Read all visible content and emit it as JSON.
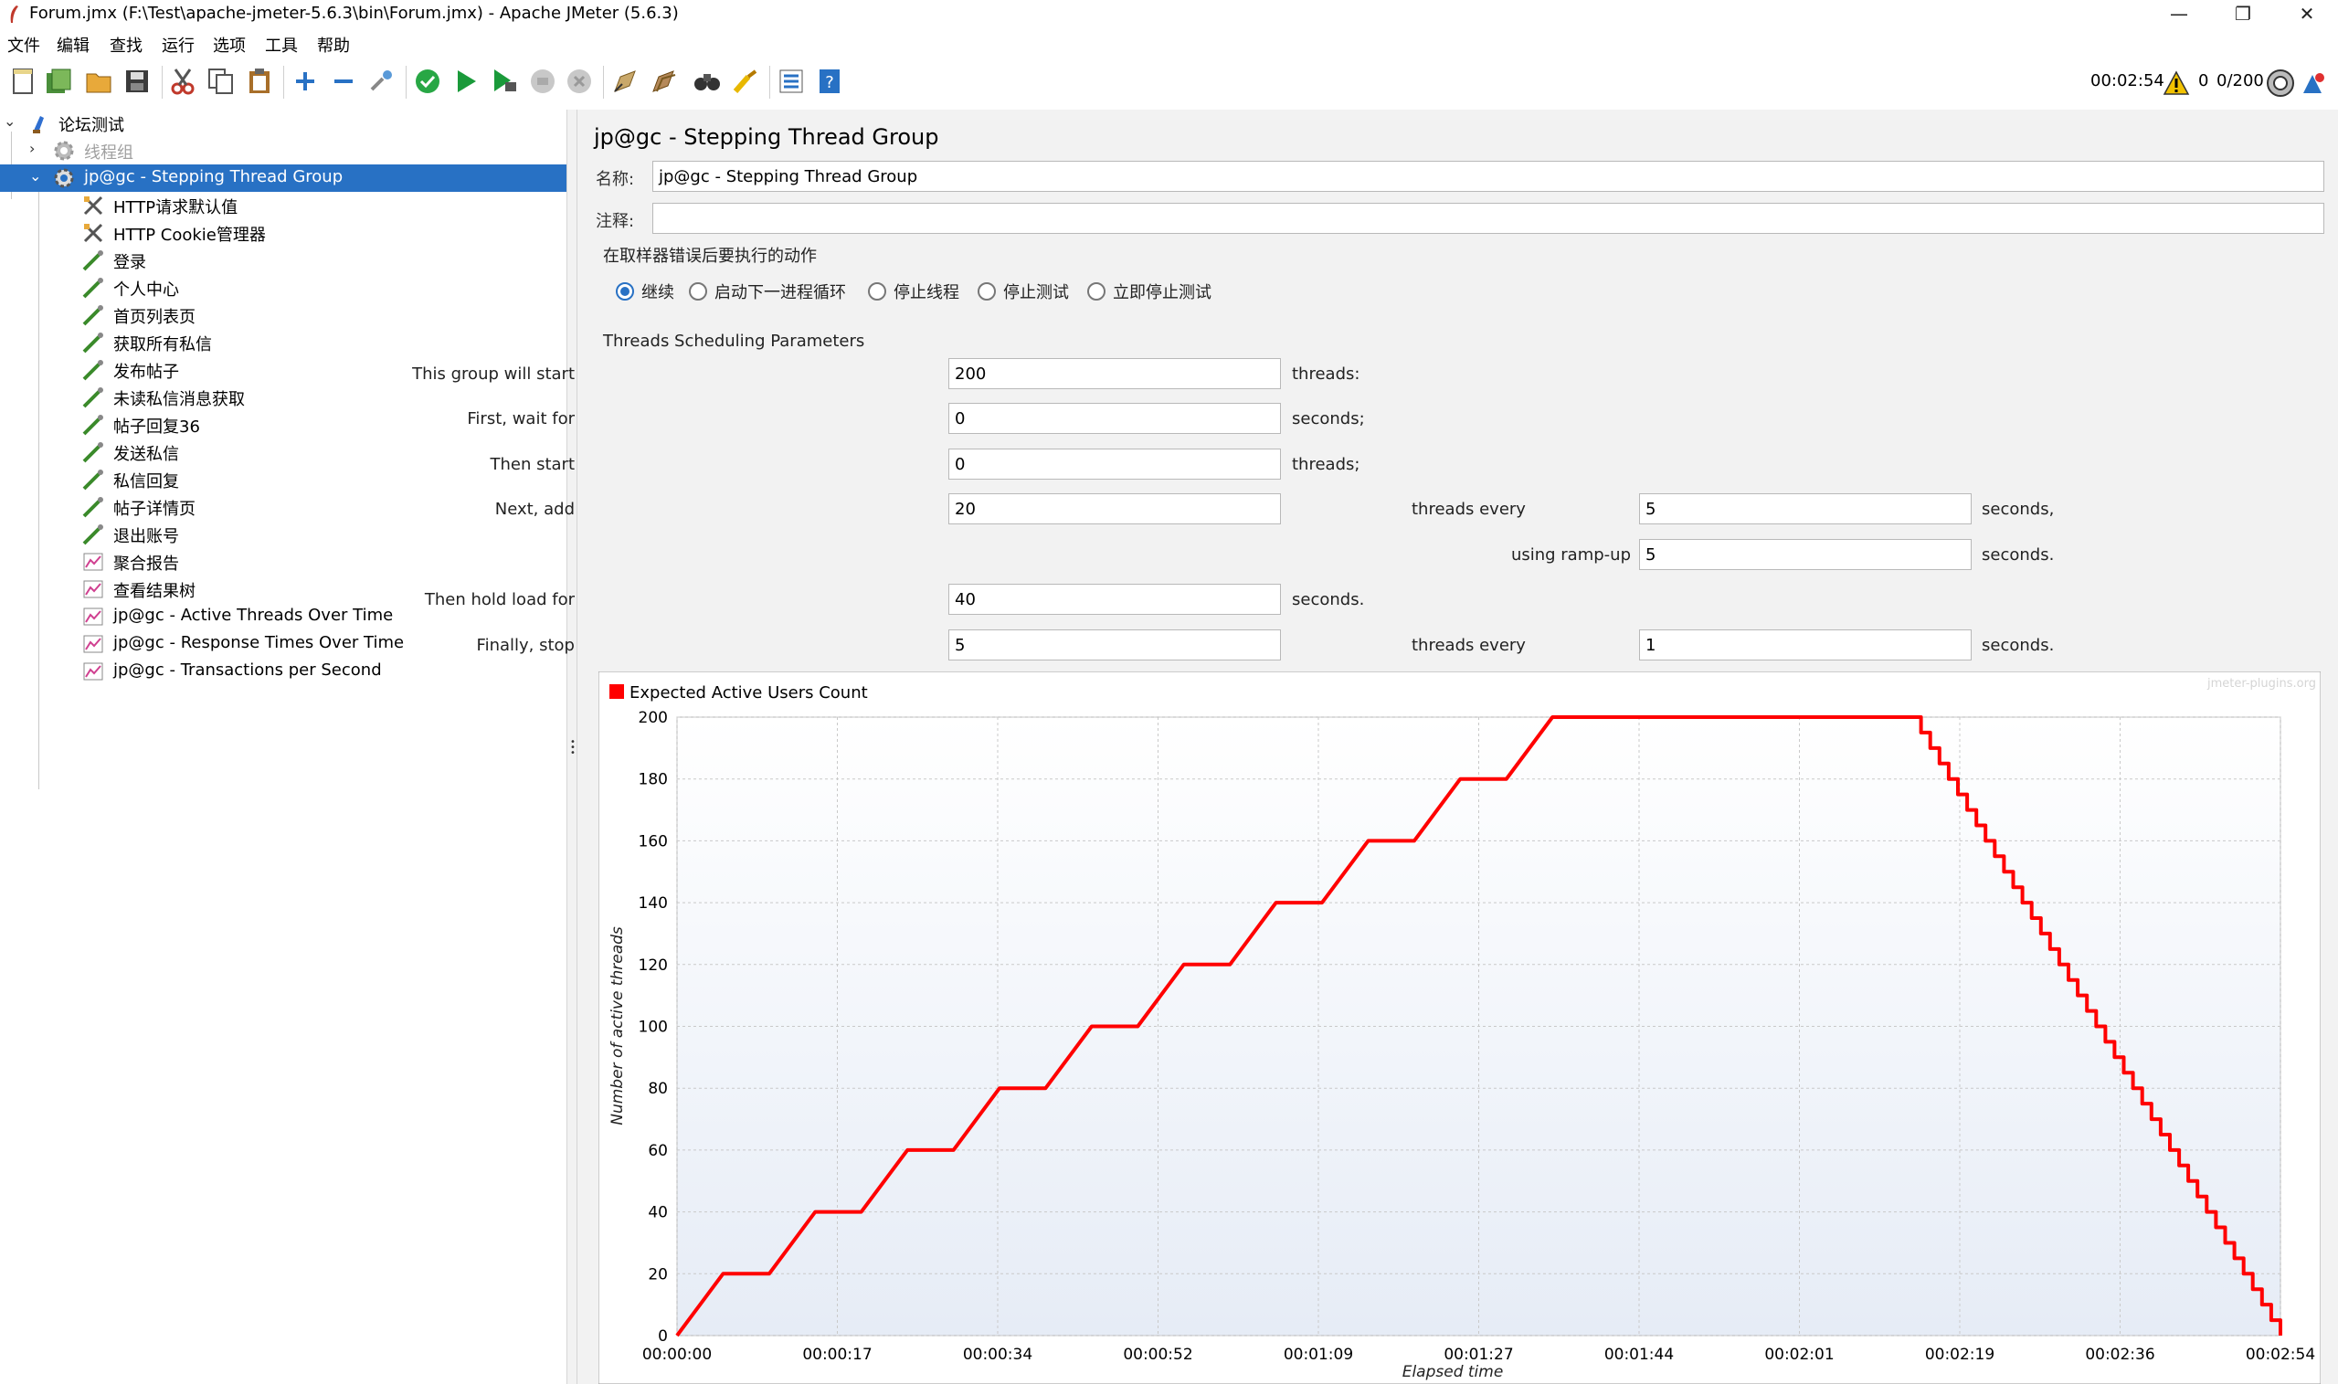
{
  "window": {
    "title": "Forum.jmx (F:\\Test\\apache-jmeter-5.6.3\\bin\\Forum.jmx) - Apache JMeter (5.6.3)",
    "minimize": "—",
    "maximize": "❐",
    "close": "✕"
  },
  "menu": [
    "文件",
    "编辑",
    "查找",
    "运行",
    "选项",
    "工具",
    "帮助"
  ],
  "toolbar": {
    "icons": [
      "new-icon",
      "templates-icon",
      "open-icon",
      "save-icon",
      "cut-icon",
      "copy-icon",
      "paste-icon",
      "expand-icon",
      "collapse-icon",
      "toggle-icon",
      "start-icon",
      "start-no-pauses-icon",
      "start-remote-icon",
      "stop-icon",
      "shutdown-icon",
      "clear-icon",
      "clear-all-icon",
      "search-icon",
      "reset-search-icon",
      "function-helper-icon",
      "help-icon"
    ],
    "elapsed": "00:02:54",
    "warnings": "0",
    "threads": "0/200"
  },
  "tree": {
    "root": "论坛测试",
    "items": [
      {
        "label": "线程组",
        "icon": "gear-icon",
        "disabled": true
      },
      {
        "label": "jp@gc - Stepping Thread Group",
        "icon": "gear-icon",
        "selected": true
      },
      {
        "label": "HTTP请求默认值",
        "icon": "config-icon"
      },
      {
        "label": "HTTP Cookie管理器",
        "icon": "config-icon"
      },
      {
        "label": "登录",
        "icon": "sampler-icon"
      },
      {
        "label": "个人中心",
        "icon": "sampler-icon"
      },
      {
        "label": "首页列表页",
        "icon": "sampler-icon"
      },
      {
        "label": "获取所有私信",
        "icon": "sampler-icon"
      },
      {
        "label": "发布帖子",
        "icon": "sampler-icon"
      },
      {
        "label": "未读私信消息获取",
        "icon": "sampler-icon"
      },
      {
        "label": "帖子回复36",
        "icon": "sampler-icon"
      },
      {
        "label": "发送私信",
        "icon": "sampler-icon"
      },
      {
        "label": "私信回复",
        "icon": "sampler-icon"
      },
      {
        "label": "帖子详情页",
        "icon": "sampler-icon"
      },
      {
        "label": "退出账号",
        "icon": "sampler-icon"
      },
      {
        "label": "聚合报告",
        "icon": "listener-icon"
      },
      {
        "label": "查看结果树",
        "icon": "listener-icon"
      },
      {
        "label": "jp@gc - Active Threads Over Time",
        "icon": "listener-icon"
      },
      {
        "label": "jp@gc - Response Times Over Time",
        "icon": "listener-icon"
      },
      {
        "label": "jp@gc - Transactions per Second",
        "icon": "listener-icon"
      }
    ]
  },
  "panel": {
    "title": "jp@gc - Stepping Thread Group",
    "name_label": "名称:",
    "name_value": "jp@gc - Stepping Thread Group",
    "comment_label": "注释:",
    "comment_value": "",
    "error_section": "在取样器错误后要执行的动作",
    "error_options": [
      "继续",
      "启动下一进程循环",
      "停止线程",
      "停止测试",
      "立即停止测试"
    ],
    "error_selected": 0,
    "sched_section": "Threads Scheduling Parameters",
    "params": {
      "start_label": "This group will start",
      "start_value": "200",
      "start_unit": "threads:",
      "wait_label": "First, wait for",
      "wait_value": "0",
      "wait_unit": "seconds;",
      "then_label": "Then start",
      "then_value": "0",
      "then_unit": "threads;",
      "next_label": "Next, add",
      "next_value": "20",
      "next_mid": "threads every",
      "next_every": "5",
      "next_unit": "seconds,",
      "ramp_label": "using ramp-up",
      "ramp_value": "5",
      "ramp_unit": "seconds.",
      "hold_label": "Then hold load for",
      "hold_value": "40",
      "hold_unit": "seconds.",
      "stop_label": "Finally, stop",
      "stop_value": "5",
      "stop_mid": "threads every",
      "stop_every": "1",
      "stop_unit": "seconds."
    }
  },
  "colors": {
    "selection": "#2871c4",
    "series": "#ff0000",
    "panel_bg": "#f2f2f2"
  },
  "chart_data": {
    "type": "line",
    "title": "",
    "legend": "Expected Active Users Count",
    "watermark": "jmeter-plugins.org",
    "xlabel": "Elapsed time",
    "ylabel": "Number of active threads",
    "x_ticks": [
      "00:00:00",
      "00:00:17",
      "00:00:34",
      "00:00:52",
      "00:01:09",
      "00:01:27",
      "00:01:44",
      "00:02:01",
      "00:02:19",
      "00:02:36",
      "00:02:54"
    ],
    "y_ticks": [
      0,
      20,
      40,
      60,
      80,
      100,
      120,
      140,
      160,
      180,
      200
    ],
    "xlim": [
      0,
      174
    ],
    "ylim": [
      0,
      200
    ],
    "x_units": "seconds",
    "series": [
      {
        "name": "Expected Active Users Count",
        "x": [
          0,
          5,
          10,
          15,
          20,
          25,
          30,
          35,
          40,
          45,
          50,
          55,
          60,
          65,
          70,
          75,
          80,
          85,
          90,
          95,
          135,
          135,
          136,
          136,
          137,
          137,
          138,
          138,
          139,
          139,
          140,
          140,
          141,
          141,
          142,
          142,
          143,
          143,
          144,
          144,
          145,
          145,
          146,
          146,
          147,
          147,
          148,
          148,
          149,
          149,
          150,
          150,
          151,
          151,
          152,
          152,
          153,
          153,
          154,
          154,
          155,
          155,
          156,
          156,
          157,
          157,
          158,
          158,
          159,
          159,
          160,
          160,
          161,
          161,
          162,
          162,
          163,
          163,
          164,
          164,
          165,
          165,
          166,
          166,
          167,
          167,
          168,
          168,
          169,
          169,
          170,
          170,
          171,
          171,
          172,
          172,
          173,
          173,
          174,
          174
        ],
        "values": [
          0,
          20,
          20,
          40,
          40,
          60,
          60,
          80,
          80,
          100,
          100,
          120,
          120,
          140,
          140,
          160,
          160,
          180,
          180,
          200,
          200,
          195,
          195,
          190,
          190,
          185,
          185,
          180,
          180,
          175,
          175,
          170,
          170,
          165,
          165,
          160,
          160,
          155,
          155,
          150,
          150,
          145,
          145,
          140,
          140,
          135,
          135,
          130,
          130,
          125,
          125,
          120,
          120,
          115,
          115,
          110,
          110,
          105,
          105,
          100,
          100,
          95,
          95,
          90,
          90,
          85,
          85,
          80,
          80,
          75,
          75,
          70,
          70,
          65,
          65,
          60,
          60,
          55,
          55,
          50,
          50,
          45,
          45,
          40,
          40,
          35,
          35,
          30,
          30,
          25,
          25,
          20,
          20,
          15,
          15,
          10,
          10,
          5,
          5,
          0
        ]
      }
    ]
  }
}
